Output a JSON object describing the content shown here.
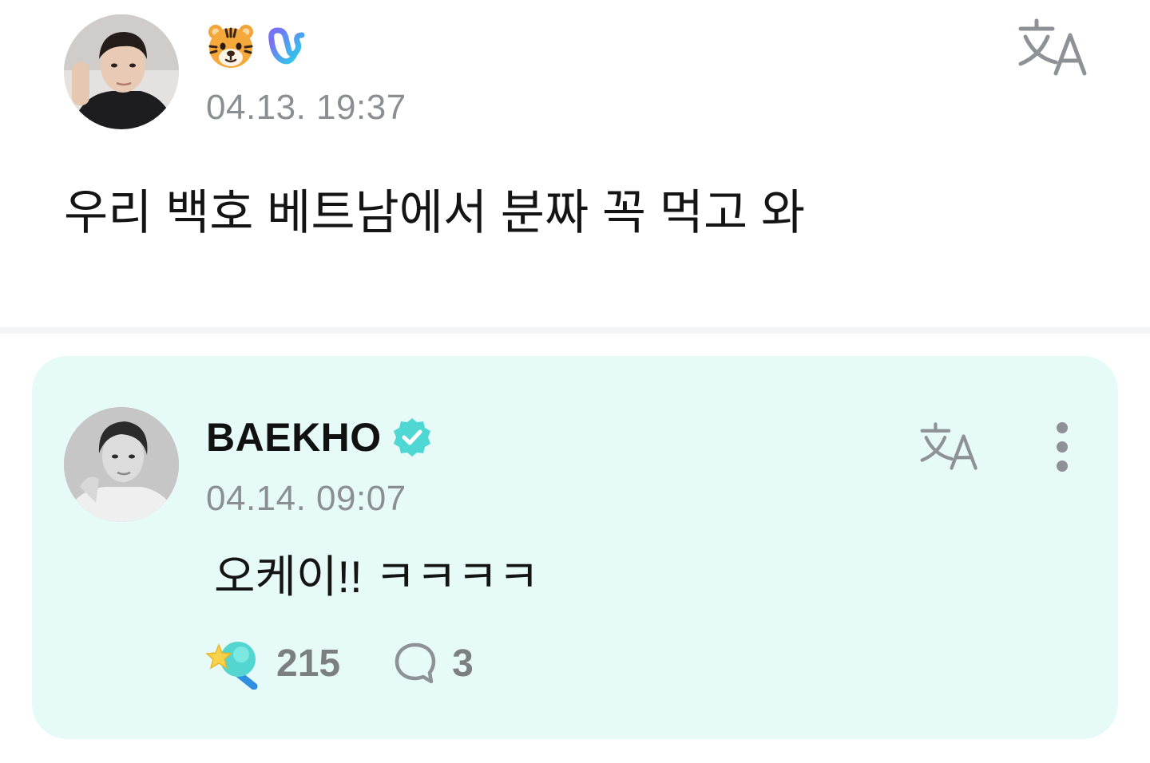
{
  "post": {
    "timestamp": "04.13. 19:37",
    "text": "우리 백호 베트남에서 분짜 꼭 먹고 와",
    "badges": [
      "tiger-emoji",
      "weverse-membership-icon"
    ],
    "actions": [
      "translate-icon"
    ]
  },
  "comment": {
    "author": "BAEKHO",
    "timestamp": "04.14. 09:07",
    "text": "오케이!! ㅋㅋㅋㅋ",
    "likes": "215",
    "replies": "3",
    "icons": [
      "verified-badge-icon",
      "translate-icon",
      "more-options-icon",
      "lightstick-like-icon",
      "comment-bubble-icon"
    ]
  },
  "colors": {
    "card_background": "#e6fbf8",
    "verified_accent": "#4fd8d3",
    "muted_text": "#8b8e92",
    "divider": "#f3f4f5"
  }
}
